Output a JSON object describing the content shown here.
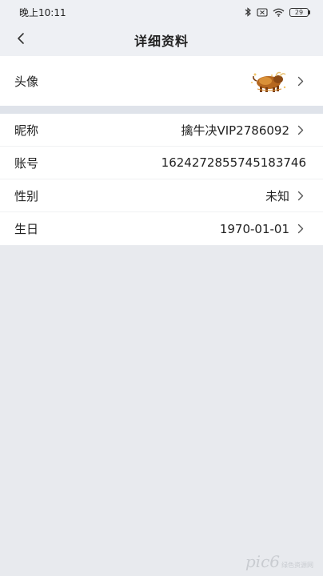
{
  "status_bar": {
    "time": "晚上10:11",
    "battery": "29"
  },
  "header": {
    "title": "详细资料"
  },
  "avatar_row": {
    "label": "头像"
  },
  "info_rows": [
    {
      "label": "昵称",
      "value": "擒牛决VIP2786092"
    },
    {
      "label": "账号",
      "value": "1624272855745183746"
    },
    {
      "label": "性别",
      "value": "未知"
    },
    {
      "label": "生日",
      "value": "1970-01-01"
    }
  ],
  "watermark": {
    "main": "pic6",
    "small": "绿色资源网"
  }
}
